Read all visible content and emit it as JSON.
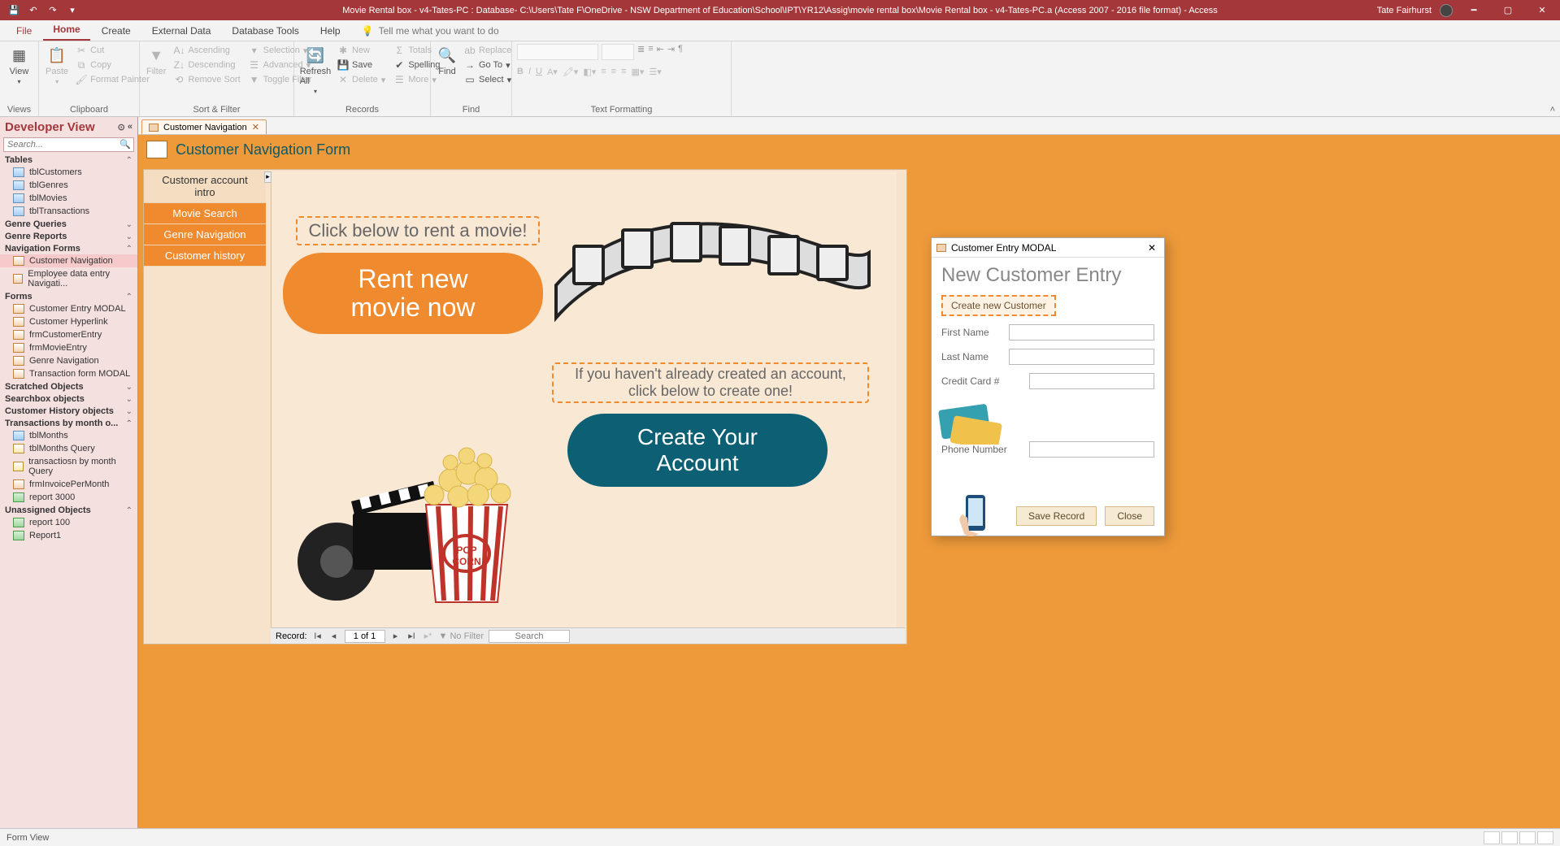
{
  "title": "Movie Rental box - v4-Tates-PC : Database- C:\\Users\\Tate F\\OneDrive - NSW Department of Education\\School\\IPT\\YR12\\Assig\\movie rental box\\Movie Rental box - v4-Tates-PC.a (Access 2007 - 2016 file format)  -  Access",
  "user": "Tate Fairhurst",
  "ribbon_tabs": {
    "file": "File",
    "home": "Home",
    "create": "Create",
    "external": "External Data",
    "dbtools": "Database Tools",
    "help": "Help",
    "tellme": "Tell me what you want to do"
  },
  "ribbon": {
    "views": {
      "view": "View",
      "group": "Views"
    },
    "clipboard": {
      "paste": "Paste",
      "cut": "Cut",
      "copy": "Copy",
      "painter": "Format Painter",
      "group": "Clipboard"
    },
    "sort": {
      "filter": "Filter",
      "asc": "Ascending",
      "desc": "Descending",
      "remove": "Remove Sort",
      "selection": "Selection",
      "advanced": "Advanced",
      "toggle": "Toggle Filter",
      "group": "Sort & Filter"
    },
    "records": {
      "refresh": "Refresh All",
      "new": "New",
      "save": "Save",
      "delete": "Delete",
      "totals": "Totals",
      "spelling": "Spelling",
      "more": "More",
      "group": "Records"
    },
    "find": {
      "find": "Find",
      "replace": "Replace",
      "goto": "Go To",
      "select": "Select",
      "group": "Find"
    },
    "text": {
      "group": "Text Formatting"
    }
  },
  "nav": {
    "header": "Developer View",
    "search_placeholder": "Search...",
    "groups": {
      "tables": "Tables",
      "tables_items": [
        "tblCustomers",
        "tblGenres",
        "tblMovies",
        "tblTransactions"
      ],
      "genre_q": "Genre Queries",
      "genre_r": "Genre Reports",
      "navforms": "Navigation Forms",
      "navforms_items": [
        "Customer Navigation",
        "Employee data entry Navigati..."
      ],
      "forms": "Forms",
      "forms_items": [
        "Customer Entry MODAL",
        "Customer Hyperlink",
        "frmCustomerEntry",
        "frmMovieEntry",
        "Genre Navigation",
        "Transaction form MODAL"
      ],
      "scratched": "Scratched Objects",
      "searchbox": "Searchbox objects",
      "custhist": "Customer History objects",
      "trans": "Transactions by month o...",
      "trans_items": [
        "tblMonths",
        "tblMonths Query",
        "transactiosn by month Query",
        "frmInvoicePerMonth",
        "report 3000"
      ],
      "unassigned": "Unassigned Objects",
      "unassigned_items": [
        "report 100",
        "Report1"
      ]
    }
  },
  "doc": {
    "tab": "Customer Navigation",
    "form_title": "Customer Navigation Form",
    "subnav": [
      "Customer account intro",
      "Movie Search",
      "Genre Navigation",
      "Customer history"
    ],
    "label1": "Click below to rent a movie!",
    "btn1a": "Rent new",
    "btn1b": "movie now",
    "label2": "If you haven't already created an account, click below to create one!",
    "btn2a": "Create Your",
    "btn2b": "Account",
    "record_label": "Record:",
    "record_pos": "1 of 1",
    "nofilter": "No Filter",
    "search": "Search"
  },
  "modal": {
    "title": "Customer Entry MODAL",
    "heading": "New Customer Entry",
    "create": "Create new Customer",
    "first": "First Name",
    "last": "Last Name",
    "cc": "Credit Card #",
    "phone": "Phone Number",
    "save": "Save Record",
    "close": "Close"
  },
  "status": {
    "left": "Form View"
  }
}
